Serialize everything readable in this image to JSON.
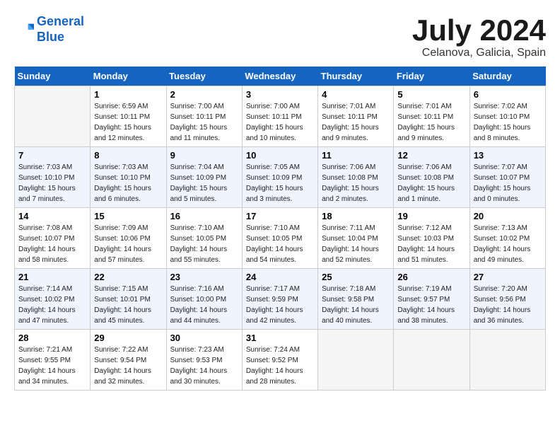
{
  "header": {
    "logo_line1": "General",
    "logo_line2": "Blue",
    "month_year": "July 2024",
    "location": "Celanova, Galicia, Spain"
  },
  "days_of_week": [
    "Sunday",
    "Monday",
    "Tuesday",
    "Wednesday",
    "Thursday",
    "Friday",
    "Saturday"
  ],
  "weeks": [
    [
      {
        "day": "",
        "info": ""
      },
      {
        "day": "1",
        "info": "Sunrise: 6:59 AM\nSunset: 10:11 PM\nDaylight: 15 hours\nand 12 minutes."
      },
      {
        "day": "2",
        "info": "Sunrise: 7:00 AM\nSunset: 10:11 PM\nDaylight: 15 hours\nand 11 minutes."
      },
      {
        "day": "3",
        "info": "Sunrise: 7:00 AM\nSunset: 10:11 PM\nDaylight: 15 hours\nand 10 minutes."
      },
      {
        "day": "4",
        "info": "Sunrise: 7:01 AM\nSunset: 10:11 PM\nDaylight: 15 hours\nand 9 minutes."
      },
      {
        "day": "5",
        "info": "Sunrise: 7:01 AM\nSunset: 10:11 PM\nDaylight: 15 hours\nand 9 minutes."
      },
      {
        "day": "6",
        "info": "Sunrise: 7:02 AM\nSunset: 10:10 PM\nDaylight: 15 hours\nand 8 minutes."
      }
    ],
    [
      {
        "day": "7",
        "info": "Sunrise: 7:03 AM\nSunset: 10:10 PM\nDaylight: 15 hours\nand 7 minutes."
      },
      {
        "day": "8",
        "info": "Sunrise: 7:03 AM\nSunset: 10:10 PM\nDaylight: 15 hours\nand 6 minutes."
      },
      {
        "day": "9",
        "info": "Sunrise: 7:04 AM\nSunset: 10:09 PM\nDaylight: 15 hours\nand 5 minutes."
      },
      {
        "day": "10",
        "info": "Sunrise: 7:05 AM\nSunset: 10:09 PM\nDaylight: 15 hours\nand 3 minutes."
      },
      {
        "day": "11",
        "info": "Sunrise: 7:06 AM\nSunset: 10:08 PM\nDaylight: 15 hours\nand 2 minutes."
      },
      {
        "day": "12",
        "info": "Sunrise: 7:06 AM\nSunset: 10:08 PM\nDaylight: 15 hours\nand 1 minute."
      },
      {
        "day": "13",
        "info": "Sunrise: 7:07 AM\nSunset: 10:07 PM\nDaylight: 15 hours\nand 0 minutes."
      }
    ],
    [
      {
        "day": "14",
        "info": "Sunrise: 7:08 AM\nSunset: 10:07 PM\nDaylight: 14 hours\nand 58 minutes."
      },
      {
        "day": "15",
        "info": "Sunrise: 7:09 AM\nSunset: 10:06 PM\nDaylight: 14 hours\nand 57 minutes."
      },
      {
        "day": "16",
        "info": "Sunrise: 7:10 AM\nSunset: 10:05 PM\nDaylight: 14 hours\nand 55 minutes."
      },
      {
        "day": "17",
        "info": "Sunrise: 7:10 AM\nSunset: 10:05 PM\nDaylight: 14 hours\nand 54 minutes."
      },
      {
        "day": "18",
        "info": "Sunrise: 7:11 AM\nSunset: 10:04 PM\nDaylight: 14 hours\nand 52 minutes."
      },
      {
        "day": "19",
        "info": "Sunrise: 7:12 AM\nSunset: 10:03 PM\nDaylight: 14 hours\nand 51 minutes."
      },
      {
        "day": "20",
        "info": "Sunrise: 7:13 AM\nSunset: 10:02 PM\nDaylight: 14 hours\nand 49 minutes."
      }
    ],
    [
      {
        "day": "21",
        "info": "Sunrise: 7:14 AM\nSunset: 10:02 PM\nDaylight: 14 hours\nand 47 minutes."
      },
      {
        "day": "22",
        "info": "Sunrise: 7:15 AM\nSunset: 10:01 PM\nDaylight: 14 hours\nand 45 minutes."
      },
      {
        "day": "23",
        "info": "Sunrise: 7:16 AM\nSunset: 10:00 PM\nDaylight: 14 hours\nand 44 minutes."
      },
      {
        "day": "24",
        "info": "Sunrise: 7:17 AM\nSunset: 9:59 PM\nDaylight: 14 hours\nand 42 minutes."
      },
      {
        "day": "25",
        "info": "Sunrise: 7:18 AM\nSunset: 9:58 PM\nDaylight: 14 hours\nand 40 minutes."
      },
      {
        "day": "26",
        "info": "Sunrise: 7:19 AM\nSunset: 9:57 PM\nDaylight: 14 hours\nand 38 minutes."
      },
      {
        "day": "27",
        "info": "Sunrise: 7:20 AM\nSunset: 9:56 PM\nDaylight: 14 hours\nand 36 minutes."
      }
    ],
    [
      {
        "day": "28",
        "info": "Sunrise: 7:21 AM\nSunset: 9:55 PM\nDaylight: 14 hours\nand 34 minutes."
      },
      {
        "day": "29",
        "info": "Sunrise: 7:22 AM\nSunset: 9:54 PM\nDaylight: 14 hours\nand 32 minutes."
      },
      {
        "day": "30",
        "info": "Sunrise: 7:23 AM\nSunset: 9:53 PM\nDaylight: 14 hours\nand 30 minutes."
      },
      {
        "day": "31",
        "info": "Sunrise: 7:24 AM\nSunset: 9:52 PM\nDaylight: 14 hours\nand 28 minutes."
      },
      {
        "day": "",
        "info": ""
      },
      {
        "day": "",
        "info": ""
      },
      {
        "day": "",
        "info": ""
      }
    ]
  ]
}
